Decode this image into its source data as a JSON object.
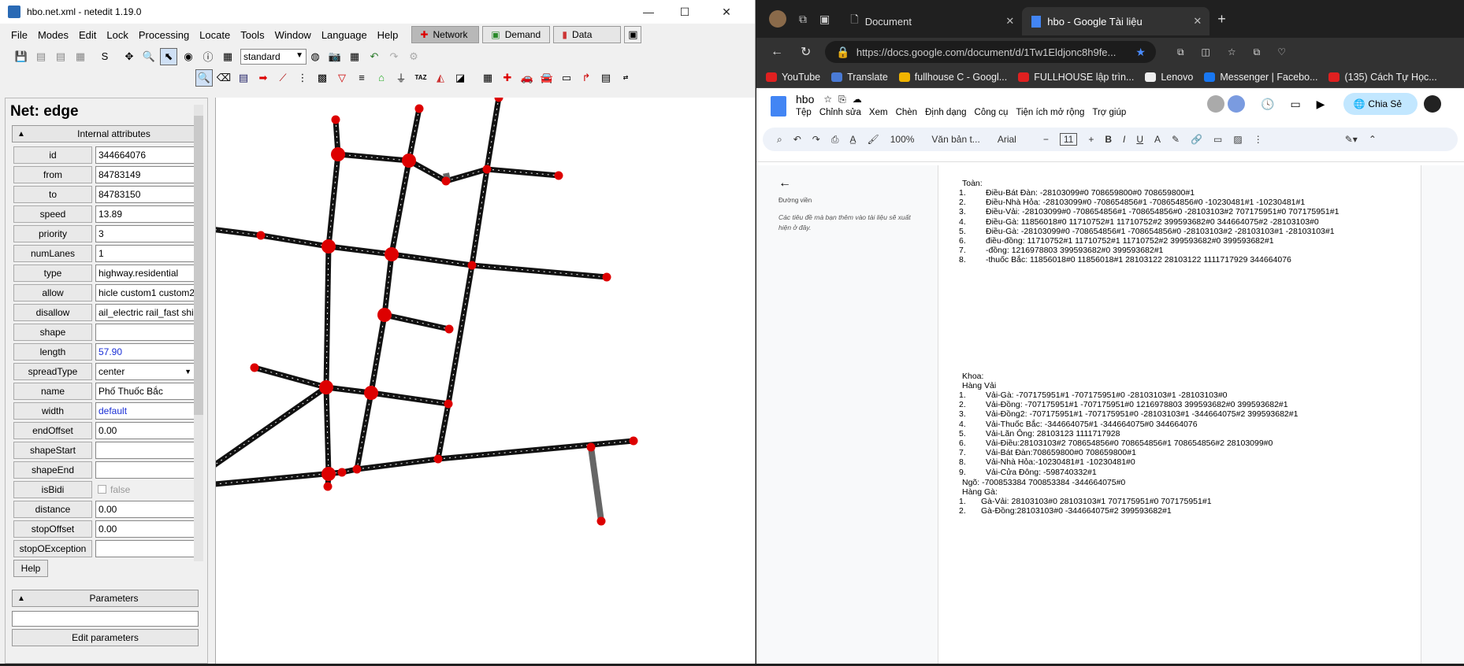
{
  "netedit": {
    "window_title": "hbo.net.xml - netedit 1.19.0",
    "menu": [
      "File",
      "Modes",
      "Edit",
      "Lock",
      "Processing",
      "Locate",
      "Tools",
      "Window",
      "Language",
      "Help"
    ],
    "modes": {
      "network": "Network",
      "demand": "Demand",
      "data": "Data"
    },
    "toolbar": {
      "s_label": "S",
      "scheme_select": "standard",
      "taz_label": "TAZ"
    },
    "panel": {
      "title": "Net: edge",
      "internal_attributes_label": "Internal attributes",
      "attributes": [
        {
          "label": "id",
          "value": "344664076"
        },
        {
          "label": "from",
          "value": "84783149"
        },
        {
          "label": "to",
          "value": "84783150"
        },
        {
          "label": "speed",
          "value": "13.89"
        },
        {
          "label": "priority",
          "value": "3"
        },
        {
          "label": "numLanes",
          "value": "1"
        },
        {
          "label": "type",
          "value": "highway.residential"
        },
        {
          "label": "allow",
          "value": "hicle custom1 custom2"
        },
        {
          "label": "disallow",
          "value": "ail_electric rail_fast ship"
        },
        {
          "label": "shape",
          "value": ""
        },
        {
          "label": "length",
          "value": "57.90"
        },
        {
          "label": "spreadType",
          "value": "center"
        },
        {
          "label": "name",
          "value": "Phố Thuốc Bắc"
        },
        {
          "label": "width",
          "value": "default"
        },
        {
          "label": "endOffset",
          "value": "0.00"
        },
        {
          "label": "shapeStart",
          "value": ""
        },
        {
          "label": "shapeEnd",
          "value": ""
        },
        {
          "label": "isBidi",
          "value": "false"
        },
        {
          "label": "distance",
          "value": "0.00"
        },
        {
          "label": "stopOffset",
          "value": "0.00"
        },
        {
          "label": "stopOException",
          "value": ""
        }
      ],
      "help_label": "Help",
      "parameters_label": "Parameters",
      "edit_parameters_label": "Edit parameters"
    },
    "colors": {
      "node": "#dd0000",
      "edge": "#111111",
      "selected_edge": "#666666"
    }
  },
  "browser": {
    "tabs": [
      {
        "title": "Document"
      },
      {
        "title": "hbo - Google Tài liệu"
      }
    ],
    "url": "https://docs.google.com/document/d/1Tw1Eldjonc8h9fe...",
    "bookmarks": [
      "YouTube",
      "Translate",
      "fullhouse C - Googl...",
      "FULLHOUSE lập trìn...",
      "Lenovo",
      "Messenger | Facebo...",
      "(135) Cách Tự Học..."
    ]
  },
  "docs": {
    "title": "hbo",
    "menu": [
      "Tệp",
      "Chỉnh sửa",
      "Xem",
      "Chèn",
      "Định dạng",
      "Công cụ",
      "Tiện ích mở rộng",
      "Trợ giúp"
    ],
    "share_label": "Chia Sẻ",
    "toolbar": {
      "zoom": "100%",
      "style": "Văn bản t...",
      "font": "Arial",
      "size": "11"
    },
    "outline_title": "Đường viền",
    "outline_hint": "Các tiêu đề mà bạn thêm vào tài liệu sẽ xuất hiện ở đây.",
    "toan_heading": "Toàn:",
    "toan": [
      "Điều-Bát Đàn: -28103099#0 708659800#0 708659800#1",
      "Điều-Nhà Hỏa: -28103099#0 -708654856#1 -708654856#0 -10230481#1 -10230481#1",
      "Điều-Vải:  -28103099#0 -708654856#1 -708654856#0 -28103103#2 707175951#0 707175951#1",
      "Điều-Gà: 11856018#0 11710752#1 11710752#2 399593682#0 344664075#2 -28103103#0",
      "Điều-Gà:  -28103099#0 -708654856#1 -708654856#0 -28103103#2 -28103103#1 -28103103#1",
      "điều-đồng: 11710752#1 11710752#1 11710752#2 399593682#0 399593682#1",
      "-đồng: 1216978803 399593682#0 399593682#1",
      "-thuốc Bắc: 11856018#0 11856018#1 28103122 28103122 1111717929 344664076"
    ],
    "khoa_heading": "Khoa:",
    "hang_vai_heading": "Hàng Vải",
    "hang_vai": [
      "Vải-Gà: -707175951#1 -707175951#0 -28103103#1 -28103103#0",
      "Vải-Đồng: -707175951#1 -707175951#0 1216978803 399593682#0 399593682#1",
      "Vải-Đồng2: -707175951#1 -707175951#0 -28103103#1 -344664075#2 399593682#1",
      "Vải-Thuốc Bắc: -344664075#1 -344664075#0 344664076",
      "Vải-Lãn Ông: 28103123 1111717928",
      "Vải-Điều:28103103#2 708654856#0 708654856#1 708654856#2 28103099#0",
      "Vải-Bát Đàn:708659800#0 708659800#1",
      "Vải-Nhà Hỏa:-10230481#1 -10230481#0",
      "Vải-Cửa Đông: -598740332#1"
    ],
    "ngo": "Ngõ: -700853384 700853384 -344664075#0",
    "hang_ga_heading": "Hàng Gà:",
    "hang_ga": [
      "Gà-Vải: 28103103#0 28103103#1 707175951#0 707175951#1",
      "Gà-Đồng:28103103#0 -344664075#2 399593682#1"
    ]
  }
}
